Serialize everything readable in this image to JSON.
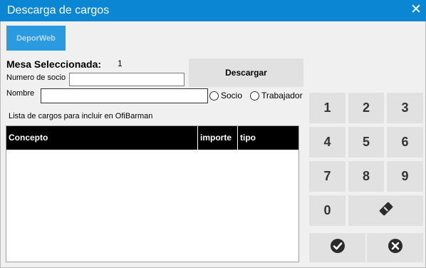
{
  "window": {
    "title": "Descarga de cargos",
    "close_icon": "close-icon"
  },
  "toolbar": {
    "deporweb_label": "DeporWeb"
  },
  "mesa": {
    "label": "Mesa Seleccionada:",
    "value": "1"
  },
  "form": {
    "socio_label": "Numero de socio",
    "socio_value": "",
    "nombre_label": "Nombre",
    "nombre_value": "",
    "radio_socio": "Socio",
    "radio_trabajador": "Trabajador"
  },
  "actions": {
    "descargar": "Descargar"
  },
  "list": {
    "caption": "Lista de cargos para incluir en OfiBarman",
    "columns": [
      "Concepto",
      "importe",
      "tipo"
    ],
    "rows": []
  },
  "keypad": {
    "digits": [
      "1",
      "2",
      "3",
      "4",
      "5",
      "6",
      "7",
      "8",
      "9",
      "0"
    ],
    "backspace_icon": "eraser-icon",
    "confirm_icon": "check-circle-icon",
    "cancel_icon": "x-circle-icon"
  },
  "colors": {
    "titlebar": "#0b86d3",
    "deporweb_button": "#2a9be0",
    "grid_header": "#000000",
    "key": "#e1e1e1"
  }
}
